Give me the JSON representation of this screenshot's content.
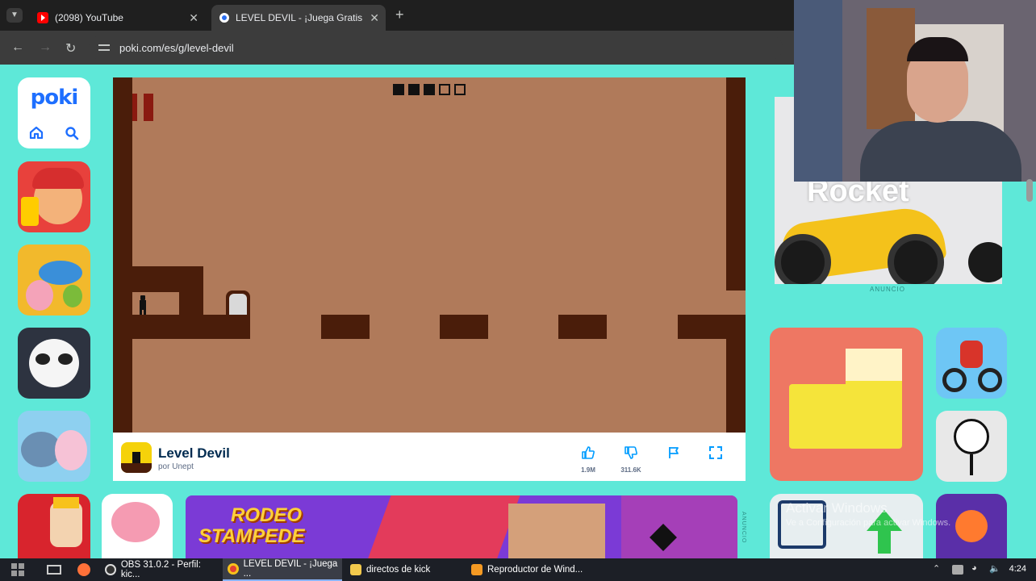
{
  "browser": {
    "tabs": [
      {
        "title": "(2098) YouTube",
        "icon": "youtube-icon",
        "active": false
      },
      {
        "title": "LEVEL DEVIL - ¡Juega Gratis Onl",
        "icon": "poki-favicon-icon",
        "active": true
      }
    ],
    "url": "poki.com/es/g/level-devil"
  },
  "game": {
    "title": "Level Devil",
    "author": "por Unept",
    "likes": "1.9M",
    "dislikes": "311.6K"
  },
  "ads": {
    "right_ad_text": "Rocket",
    "right_ad_label": "ANUNCIO",
    "banner_title_line1": "RODEO",
    "banner_title_line2": "STAMPEDE",
    "banner_ad_label": "ANUNCIO"
  },
  "windows_watermark": {
    "title": "Activar Windows",
    "subtitle": "Ve a Configuración para activar Windows."
  },
  "taskbar": {
    "items": [
      {
        "label": "OBS 31.0.2 - Perfil: kic..."
      },
      {
        "label": "LEVEL DEVIL - ¡Juega ..."
      },
      {
        "label": "directos de kick"
      },
      {
        "label": "Reproductor de Wind..."
      }
    ],
    "clock": "4:24"
  },
  "colors": {
    "page_bg": "#5ee8d8",
    "game_bg": "#b07a5a",
    "game_wall": "#4a1d0a",
    "poki_blue": "#1e6fff"
  }
}
